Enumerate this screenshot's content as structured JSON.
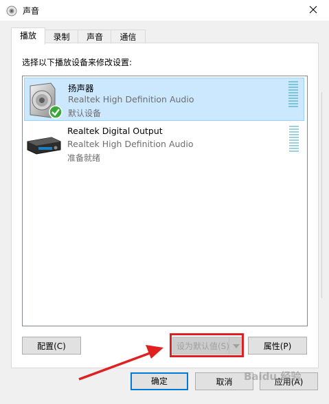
{
  "window": {
    "title": "声音",
    "title_icon": "speaker-icon",
    "close_icon": "close-icon"
  },
  "tabs": [
    {
      "label": "播放",
      "active": true
    },
    {
      "label": "录制",
      "active": false
    },
    {
      "label": "声音",
      "active": false
    },
    {
      "label": "通信",
      "active": false
    }
  ],
  "panel": {
    "instruction": "选择以下播放设备来修改设置:"
  },
  "devices": [
    {
      "name": "扬声器",
      "driver": "Realtek High Definition Audio",
      "status": "默认设备",
      "icon": "speaker-icon",
      "selected": true
    },
    {
      "name": "Realtek Digital Output",
      "driver": "Realtek High Definition Audio",
      "status": "准备就绪",
      "icon": "digital-output-icon",
      "selected": false
    }
  ],
  "buttons": {
    "configure": "配置(C)",
    "set_default": "设为默认值(S)",
    "properties": "属性(P)",
    "ok": "确定",
    "cancel": "取消",
    "apply": "应用(A)"
  },
  "watermark": "Baidu 经验",
  "colors": {
    "selection": "#cce8ff",
    "highlight_box": "#e02020",
    "accent": "#0078d7"
  }
}
